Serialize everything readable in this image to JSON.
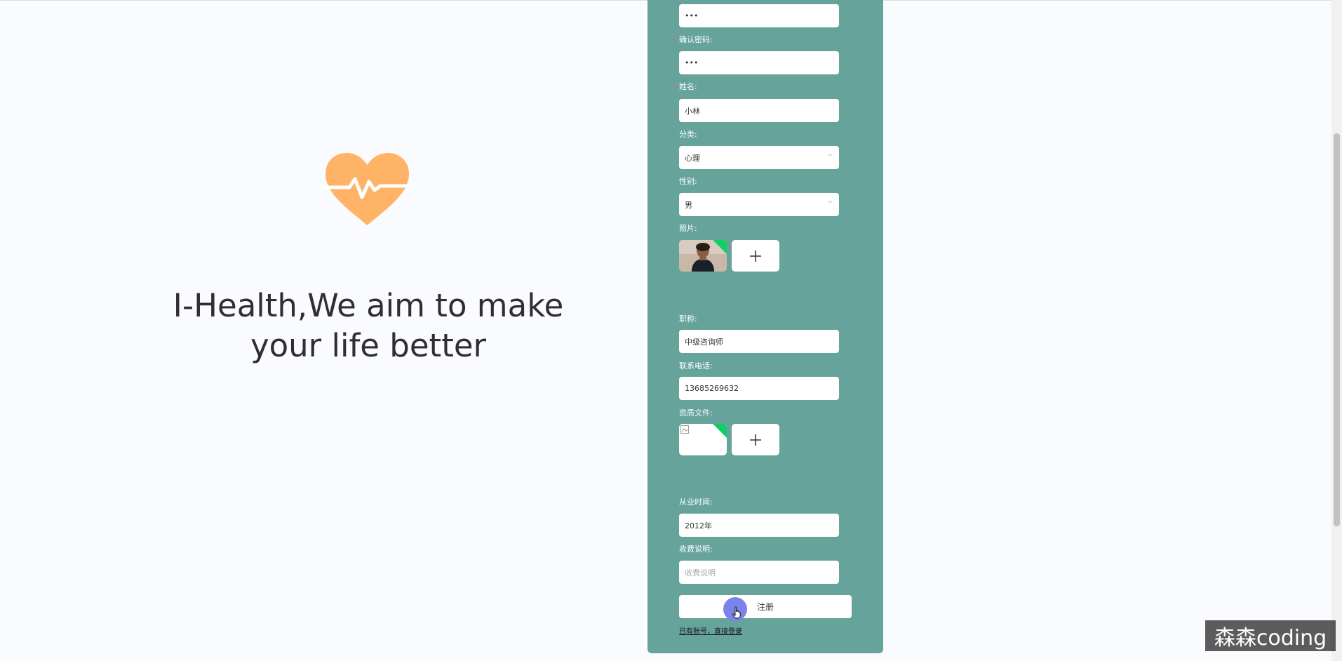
{
  "hero": {
    "tagline": "I-Health,We aim to make your life better"
  },
  "form": {
    "password_value": "•••",
    "confirm_label": "确认密码:",
    "confirm_value": "•••",
    "name_label": "姓名:",
    "name_value": "小林",
    "category_label": "分类:",
    "category_value": "心理",
    "gender_label": "性别:",
    "gender_value": "男",
    "photo_label": "照片:",
    "title_label": "职称:",
    "title_value": "中级咨询师",
    "phone_label": "联系电话:",
    "phone_value": "13685269632",
    "qualification_label": "资质文件:",
    "since_label": "从业时间:",
    "since_value": "2012年",
    "fee_label": "收费说明:",
    "fee_placeholder": "收费说明",
    "submit_label": "注册",
    "login_link": "已有账号，直接登录"
  },
  "colors": {
    "panel": "#65a39b",
    "heart": "#ffb366",
    "upload_success": "#13ce66"
  },
  "watermark": "森森coding"
}
